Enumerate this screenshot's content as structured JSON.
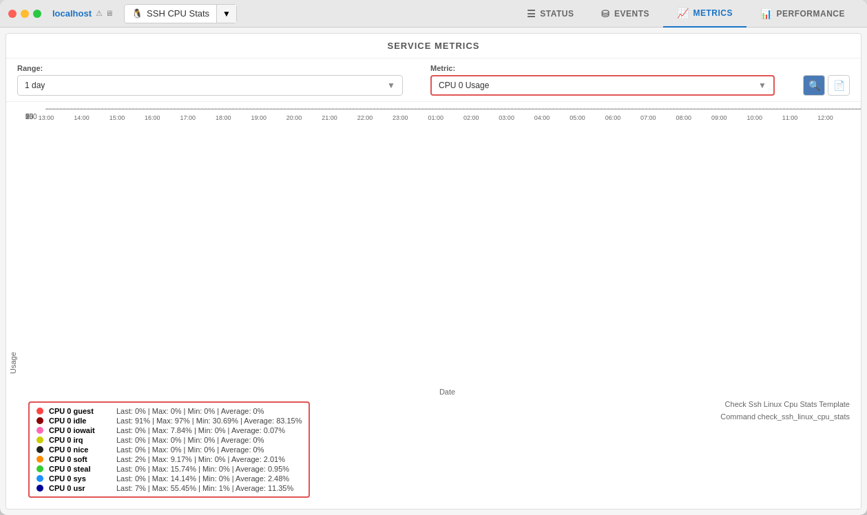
{
  "window": {
    "host": "localhost",
    "dropdown_label": "SSH CPU Stats",
    "close_label": "×"
  },
  "tabs": [
    {
      "id": "status",
      "label": "STATUS",
      "icon": "☰",
      "active": false
    },
    {
      "id": "events",
      "label": "EVENTS",
      "icon": "⛁",
      "active": false
    },
    {
      "id": "metrics",
      "label": "METRICS",
      "icon": "📈",
      "active": true
    },
    {
      "id": "performance",
      "label": "PERFORMANCE",
      "icon": "📊",
      "active": false
    }
  ],
  "section_title": "SERVICE METRICS",
  "range": {
    "label": "Range:",
    "value": "1 day"
  },
  "metric": {
    "label": "Metric:",
    "value": "CPU 0 Usage"
  },
  "buttons": {
    "search": "🔍",
    "export": "⬇"
  },
  "chart": {
    "y_axis_label": "Usage",
    "x_axis_label": "Date",
    "y_max": 100,
    "y_ticks": [
      0,
      25,
      50,
      75,
      100
    ],
    "x_ticks": [
      "13:00",
      "14:00",
      "15:00",
      "16:00",
      "17:00",
      "18:00",
      "19:00",
      "20:00",
      "21:00",
      "22:00",
      "23:00",
      "01:00",
      "02:00",
      "03:00",
      "04:00",
      "05:00",
      "06:00",
      "07:00",
      "08:00",
      "09:00",
      "10:00",
      "11:00",
      "12:00"
    ]
  },
  "legend": [
    {
      "name": "CPU 0 guest",
      "color": "#ff4444",
      "stats": "Last: 0% | Max: 0% | Min: 0% | Average: 0%"
    },
    {
      "name": "CPU 0 idle",
      "color": "#8b0000",
      "stats": "Last: 91% | Max: 97% | Min: 30.69% | Average: 83.15%"
    },
    {
      "name": "CPU 0 iowait",
      "color": "#ff69b4",
      "stats": "Last: 0% | Max: 7.84% | Min: 0% | Average: 0.07%"
    },
    {
      "name": "CPU 0 irq",
      "color": "#cccc00",
      "stats": "Last: 0% | Max: 0% | Min: 0% | Average: 0%"
    },
    {
      "name": "CPU 0 nice",
      "color": "#222222",
      "stats": "Last: 0% | Max: 0% | Min: 0% | Average: 0%"
    },
    {
      "name": "CPU 0 soft",
      "color": "#ff8c00",
      "stats": "Last: 2% | Max: 9.17% | Min: 0% | Average: 2.01%"
    },
    {
      "name": "CPU 0 steal",
      "color": "#33cc33",
      "stats": "Last: 0% | Max: 15.74% | Min: 0% | Average: 0.95%"
    },
    {
      "name": "CPU 0 sys",
      "color": "#1e90ff",
      "stats": "Last: 0% | Max: 14.14% | Min: 0% | Average: 2.48%"
    },
    {
      "name": "CPU 0 usr",
      "color": "#000099",
      "stats": "Last: 7% | Max: 55.45% | Min: 1% | Average: 11.35%"
    }
  ],
  "bottom_info": {
    "line1": "Check Ssh Linux Cpu Stats Template",
    "line2": "Command check_ssh_linux_cpu_stats"
  }
}
